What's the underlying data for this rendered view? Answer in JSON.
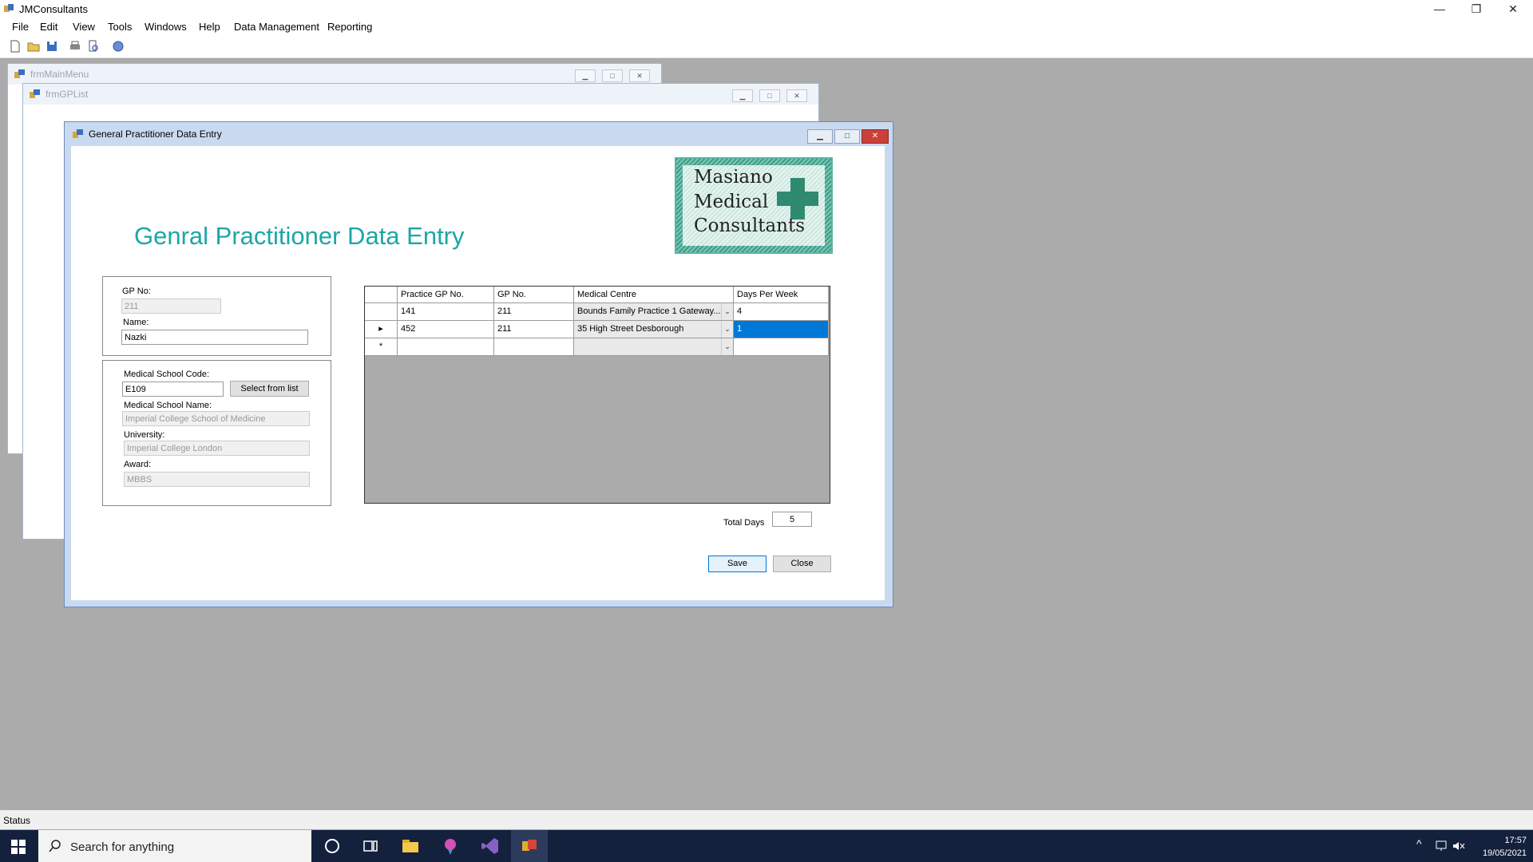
{
  "app": {
    "title": "JMConsultants"
  },
  "menu": [
    "File",
    "Edit",
    "View",
    "Tools",
    "Windows",
    "Help",
    "Data Management",
    "Reporting"
  ],
  "mdi_windows": [
    {
      "title": "frmMainMenu"
    },
    {
      "title": "frmGPList"
    }
  ],
  "dialog": {
    "title": "General Practitioner Data Entry",
    "heading": "Genral Practitioner Data Entry",
    "logo_lines": [
      "Masiano",
      "Medical",
      "Consultants"
    ],
    "gp": {
      "gp_no_label": "GP No:",
      "gp_no_value": "211",
      "name_label": "Name:",
      "name_value": "Nazki"
    },
    "school": {
      "code_label": "Medical School Code:",
      "code_value": "E109",
      "select_button": "Select from list",
      "name_label": "Medical School Name:",
      "name_value": "Imperial College School of Medicine",
      "university_label": "University:",
      "university_value": "Imperial College London",
      "award_label": "Award:",
      "award_value": "MBBS"
    },
    "grid": {
      "columns": [
        "Practice GP No.",
        "GP No.",
        "Medical Centre",
        "Days Per Week"
      ],
      "rows": [
        {
          "practice_gp_no": "141",
          "gp_no": "211",
          "medical_centre": "Bounds Family Practice 1 Gateway...",
          "days": "4"
        },
        {
          "practice_gp_no": "452",
          "gp_no": "211",
          "medical_centre": "35 High Street Desborough",
          "days": "1"
        }
      ],
      "current_row_marker": "▸",
      "new_row_marker": "*"
    },
    "total_days_label": "Total Days",
    "total_days_value": "5",
    "save_button": "Save",
    "close_button": "Close"
  },
  "status": {
    "text": "Status"
  },
  "taskbar": {
    "search_placeholder": "Search for anything",
    "time": "17:57",
    "date": "19/05/2021"
  },
  "colors": {
    "heading": "#1ca6a6",
    "selection": "#0078d7",
    "taskbar": "#14213d"
  }
}
